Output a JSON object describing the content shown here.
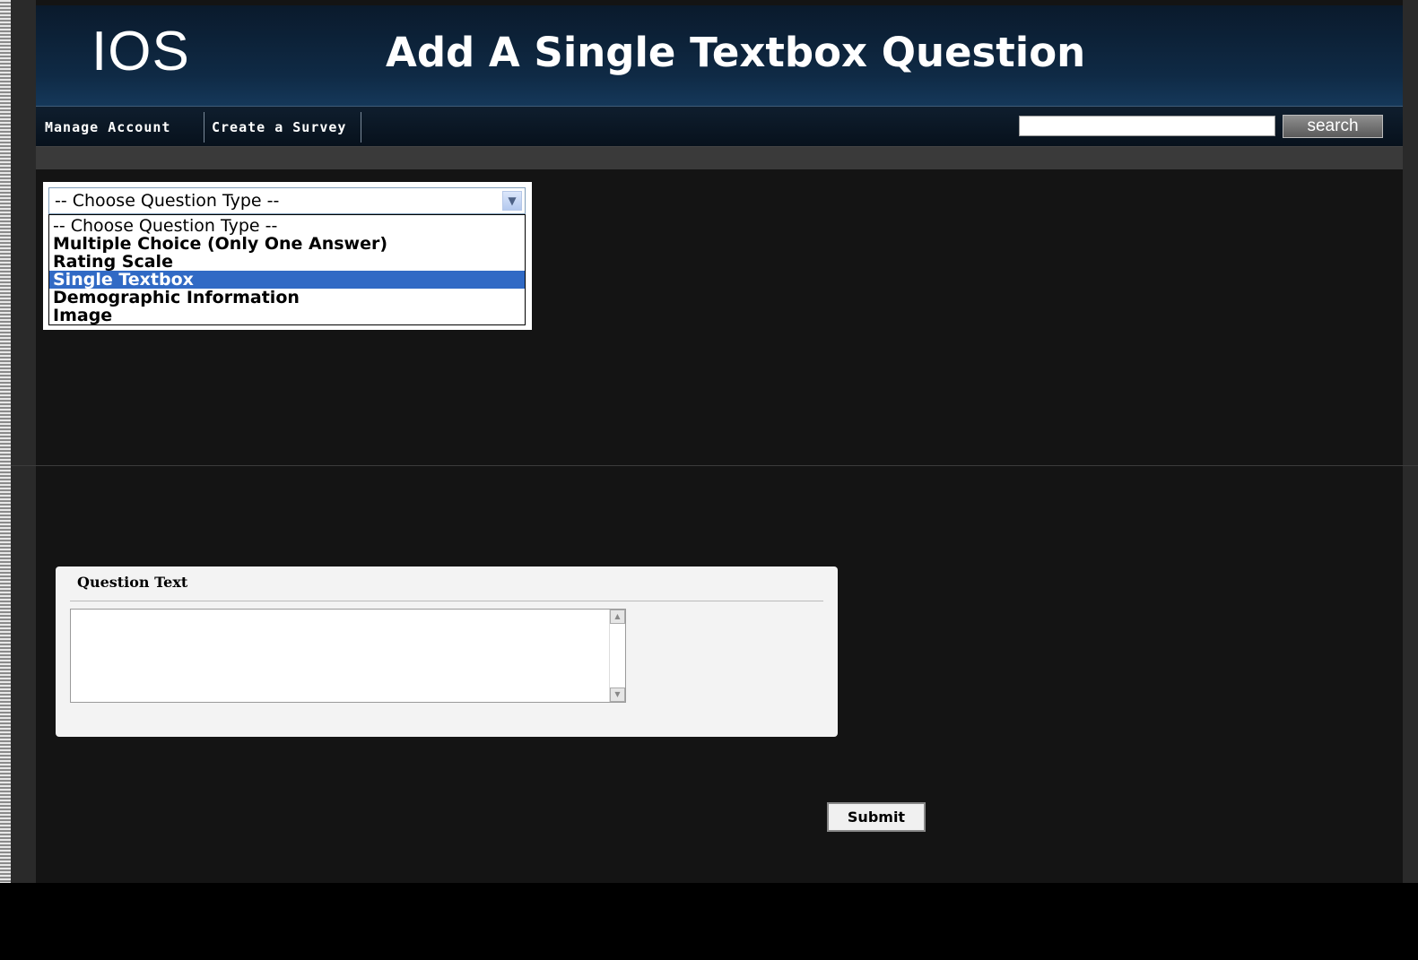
{
  "header": {
    "logo": "IOS",
    "title": "Add A Single Textbox Question"
  },
  "nav": {
    "items": [
      {
        "label": "Manage Account"
      },
      {
        "label": "Create a Survey"
      }
    ],
    "search": {
      "placeholder": "",
      "value": "",
      "button_label": "search"
    }
  },
  "question_type": {
    "selected_value": "-- Choose Question Type --",
    "options": [
      "-- Choose Question Type --",
      "Multiple Choice (Only One Answer)",
      "Rating Scale",
      "Single Textbox",
      "Demographic Information",
      "Image"
    ],
    "highlighted": "Single Textbox"
  },
  "question_form": {
    "label": "Question Text",
    "value": ""
  },
  "actions": {
    "submit_label": "Submit"
  },
  "colors": {
    "header_bg": "#0f2a45",
    "page_bg": "#141414",
    "highlight": "#316ac5"
  }
}
